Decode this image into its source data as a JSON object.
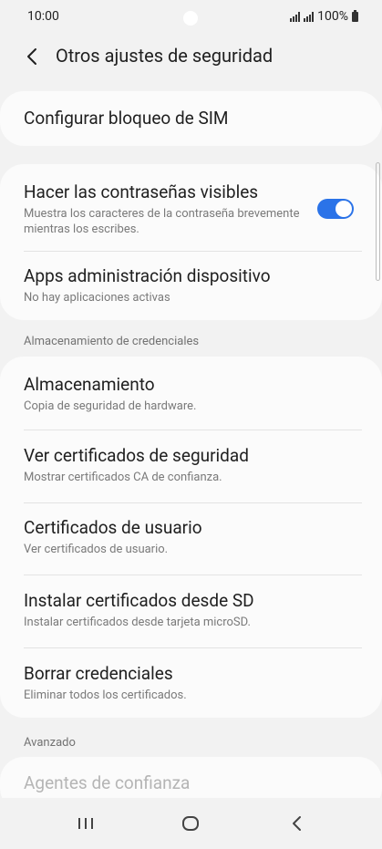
{
  "status_bar": {
    "time": "10:00",
    "battery_text": "100%"
  },
  "header": {
    "title": "Otros ajustes de seguridad",
    "back_icon": "chevron-left-icon"
  },
  "sim_lock": {
    "title": "Configurar bloqueo de SIM"
  },
  "visibility_card": {
    "items": [
      {
        "title": "Hacer las contraseñas visibles",
        "subtitle": "Muestra los caracteres de la contraseña brevemente mientras los escribes.",
        "toggle_on": true
      },
      {
        "title": "Apps administración dispositivo",
        "subtitle": "No hay aplicaciones activas"
      }
    ]
  },
  "credentials_section": {
    "header": "Almacenamiento de credenciales",
    "items": [
      {
        "title": "Almacenamiento",
        "subtitle": "Copia de seguridad de hardware."
      },
      {
        "title": "Ver certificados de seguridad",
        "subtitle": "Mostrar certificados CA de confianza."
      },
      {
        "title": "Certificados de usuario",
        "subtitle": "Ver certificados de usuario."
      },
      {
        "title": "Instalar certificados desde SD",
        "subtitle": "Instalar certificados desde tarjeta microSD."
      },
      {
        "title": "Borrar credenciales",
        "subtitle": "Eliminar todos los certificados."
      }
    ]
  },
  "advanced_section": {
    "header": "Avanzado",
    "items": [
      {
        "title": "Agentes de confianza"
      }
    ]
  },
  "colors": {
    "accent": "#2b73e8",
    "background": "#f2f2f2",
    "card": "#fbfbfb",
    "disabled_text": "#b5b5b5"
  },
  "nav_bar": {
    "recents_icon": "recents-icon",
    "home_icon": "home-icon",
    "back_icon": "back-icon"
  }
}
